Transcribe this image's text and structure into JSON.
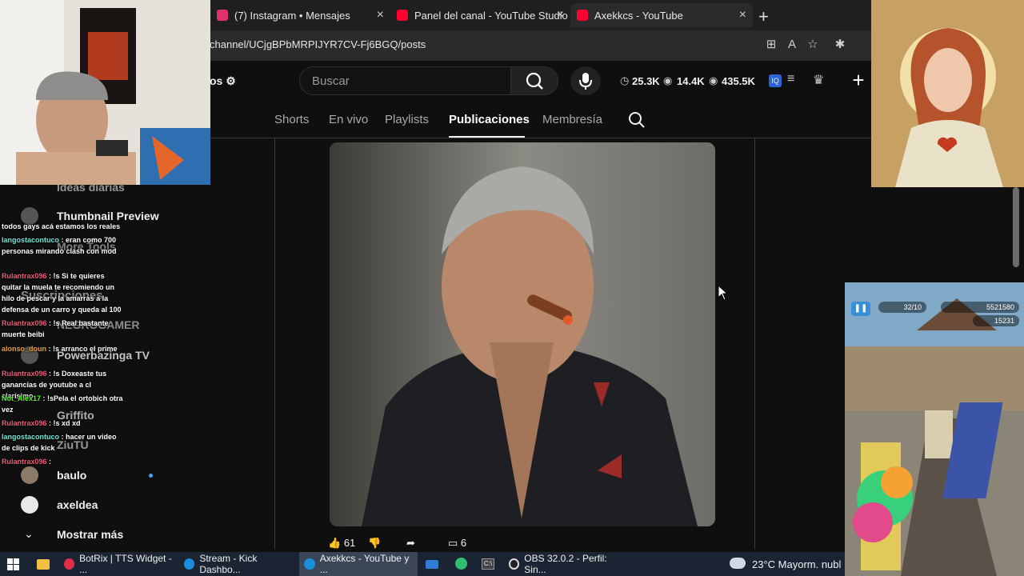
{
  "browser": {
    "tabs": [
      {
        "label": "(7) Instagram • Mensajes",
        "color": "#e1306c"
      },
      {
        "label": "Panel del canal - YouTube Studio",
        "color": "#ff0033"
      },
      {
        "label": "Axekkcs - YouTube",
        "color": "#ff0033"
      }
    ],
    "url": "channel/UCjgBPbMRPIJYR7CV-Fj6BGQ/posts",
    "add_tab_label": "+"
  },
  "youtube": {
    "left_fragment": "os",
    "search_placeholder": "Buscar",
    "stats": [
      "25.3K",
      "14.4K",
      "435.5K"
    ],
    "create_label": "+",
    "channel_tabs": [
      "Shorts",
      "En vivo",
      "Playlists",
      "Publicaciones",
      "Membresía"
    ],
    "active_tab": "Publicaciones"
  },
  "post": {
    "likes": "61",
    "comments": "6"
  },
  "sidebar": {
    "items": [
      {
        "label": "Ideas diarias"
      },
      {
        "label": "Thumbnail Preview"
      },
      {
        "label": "More Tools"
      },
      {
        "label": "Suscripciones"
      },
      {
        "label": "NEGROGAMER"
      },
      {
        "label": "Powerbazinga TV"
      },
      {
        "label": "Griffito"
      },
      {
        "label": "ZiuTU"
      },
      {
        "label": "baulo"
      },
      {
        "label": "axeldea"
      },
      {
        "label": "Mostrar más"
      }
    ]
  },
  "chat": {
    "messages": [
      {
        "user": "",
        "text": "todos gays acá estamos los reales",
        "tone": ""
      },
      {
        "user": "langostacontuco",
        "text": ": eran como 700 personas mirando clash con mod",
        "tone": "c"
      },
      {
        "user": "Rulantrax096",
        "text": ": !s Si te quieres quitar la muela te recomiendo un hilo de pescar y la amarras a la defensa de un carro y queda al 100",
        "tone": ""
      },
      {
        "user": "Rulantrax096",
        "text": ": !s Real bastante muerte beibi",
        "tone": ""
      },
      {
        "user": "alonso_doun",
        "text": ": !s arranco el prime",
        "tone": "o"
      },
      {
        "user": "Rulantrax096",
        "text": ": !s Doxeaste tus ganancias de youtube a cl clarísimo",
        "tone": ""
      },
      {
        "user": "Not_Alex17",
        "text": ": !sPela el ortobich otra vez",
        "tone": "g"
      },
      {
        "user": "Rulantrax096",
        "text": ": !s xd xd",
        "tone": ""
      },
      {
        "user": "langostacontuco",
        "text": ": hacer un video de clips de kick",
        "tone": "c"
      },
      {
        "user": "Rulantrax096",
        "text": ":",
        "tone": ""
      }
    ]
  },
  "game": {
    "counter": "32/10",
    "score": "5521580",
    "coins": "15231"
  },
  "taskbar": {
    "items": [
      {
        "label": "BotRix | TTS Widget - ..."
      },
      {
        "label": "Stream - Kick Dashbo..."
      },
      {
        "label": "Axekkcs - YouTube y ..."
      },
      {
        "label": "OBS 32.0.2 - Perfil: Sin..."
      }
    ],
    "weather": "23°C  Mayorm. nubl"
  }
}
